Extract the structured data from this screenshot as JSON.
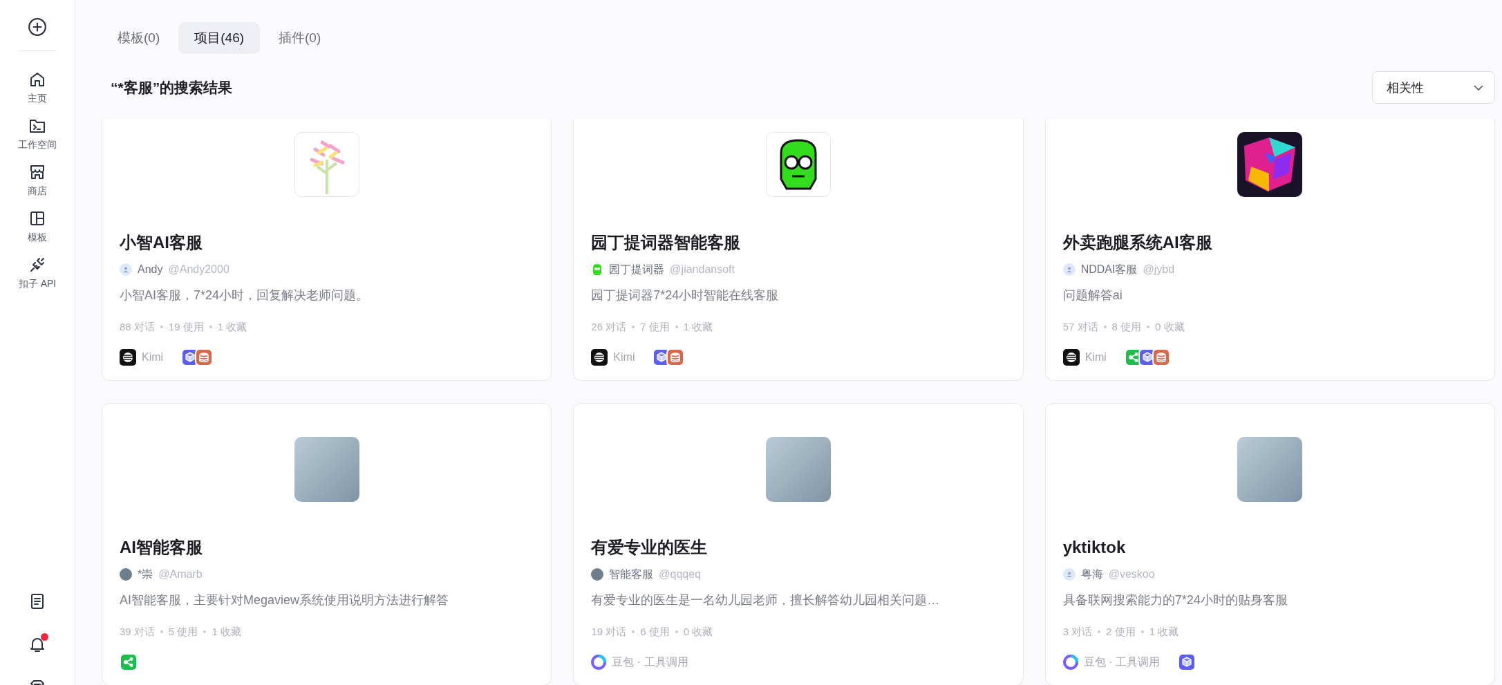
{
  "sidebar": {
    "items": [
      {
        "label": "主页",
        "kind": "home"
      },
      {
        "label": "工作空间",
        "kind": "workspace"
      },
      {
        "label": "商店",
        "kind": "store"
      },
      {
        "label": "模板",
        "kind": "template"
      },
      {
        "label": "扣子 API",
        "kind": "api"
      }
    ],
    "notification_dot": true
  },
  "tabs": [
    {
      "label": "模板(0)",
      "selected": false
    },
    {
      "label": "项目(46)",
      "selected": true
    },
    {
      "label": "插件(0)",
      "selected": false
    }
  ],
  "results_title": "“*客服”的搜索结果",
  "sort": {
    "value": "相关性"
  },
  "cards": [
    {
      "icon": {
        "kind": "tree"
      },
      "title": "小智AI客服",
      "avatar": {
        "kind": "default"
      },
      "author": "Andy",
      "handle": "@Andy2000",
      "description": "小智AI客服，7*24小时，回复解决老师问题。",
      "stats": [
        "88 对话",
        "19 使用",
        "1 收藏"
      ],
      "model": {
        "kind": "kimi",
        "label": "Kimi"
      },
      "plugins": [
        {
          "kind": "cube"
        },
        {
          "kind": "database"
        }
      ]
    },
    {
      "icon": {
        "kind": "robot"
      },
      "title": "园丁提词器智能客服",
      "avatar": {
        "kind": "robot"
      },
      "author": "园丁提词器",
      "handle": "@jiandansoft",
      "description": "园丁提词器7*24小时智能在线客服",
      "stats": [
        "26 对话",
        "7 使用",
        "1 收藏"
      ],
      "model": {
        "kind": "kimi",
        "label": "Kimi"
      },
      "plugins": [
        {
          "kind": "cube"
        },
        {
          "kind": "database"
        }
      ]
    },
    {
      "icon": {
        "kind": "cube"
      },
      "title": "外卖跑腿系统AI客服",
      "avatar": {
        "kind": "default"
      },
      "author": "NDDAI客服",
      "handle": "@jybd",
      "description": "问题解答ai",
      "stats": [
        "57 对话",
        "8 使用",
        "0 收藏"
      ],
      "model": {
        "kind": "kimi",
        "label": "Kimi"
      },
      "plugins": [
        {
          "kind": "nodes"
        },
        {
          "kind": "cube"
        },
        {
          "kind": "database"
        }
      ]
    },
    {
      "icon": {
        "kind": "photo"
      },
      "title": "AI智能客服",
      "avatar": {
        "kind": "photo"
      },
      "author": "*崇",
      "handle": "@Amarb",
      "description": "AI智能客服，主要针对Megaview系统使用说明方法进行解答",
      "stats": [
        "39 对话",
        "5 使用",
        "1 收藏"
      ],
      "plugins": [
        {
          "kind": "nodes"
        }
      ]
    },
    {
      "icon": {
        "kind": "photo"
      },
      "title": "有爱专业的医生",
      "avatar": {
        "kind": "photo"
      },
      "author": "智能客服",
      "handle": "@qqqeq",
      "description": "有爱专业的医生是一名幼儿园老师，擅长解答幼儿园相关问题…",
      "stats": [
        "19 对话",
        "6 使用",
        "0 收藏"
      ],
      "model": {
        "kind": "doubao",
        "label": "豆包 · 工具调用"
      }
    },
    {
      "icon": {
        "kind": "photo"
      },
      "title": "yktiktok",
      "avatar": {
        "kind": "default"
      },
      "author": "粤海",
      "handle": "@veskoo",
      "description": "具备联网搜索能力的7*24小时的贴身客服",
      "stats": [
        "3 对话",
        "2 使用",
        "1 收藏"
      ],
      "model": {
        "kind": "doubao",
        "label": "豆包 · 工具调用"
      },
      "plugins": [
        {
          "kind": "cube"
        }
      ]
    }
  ]
}
